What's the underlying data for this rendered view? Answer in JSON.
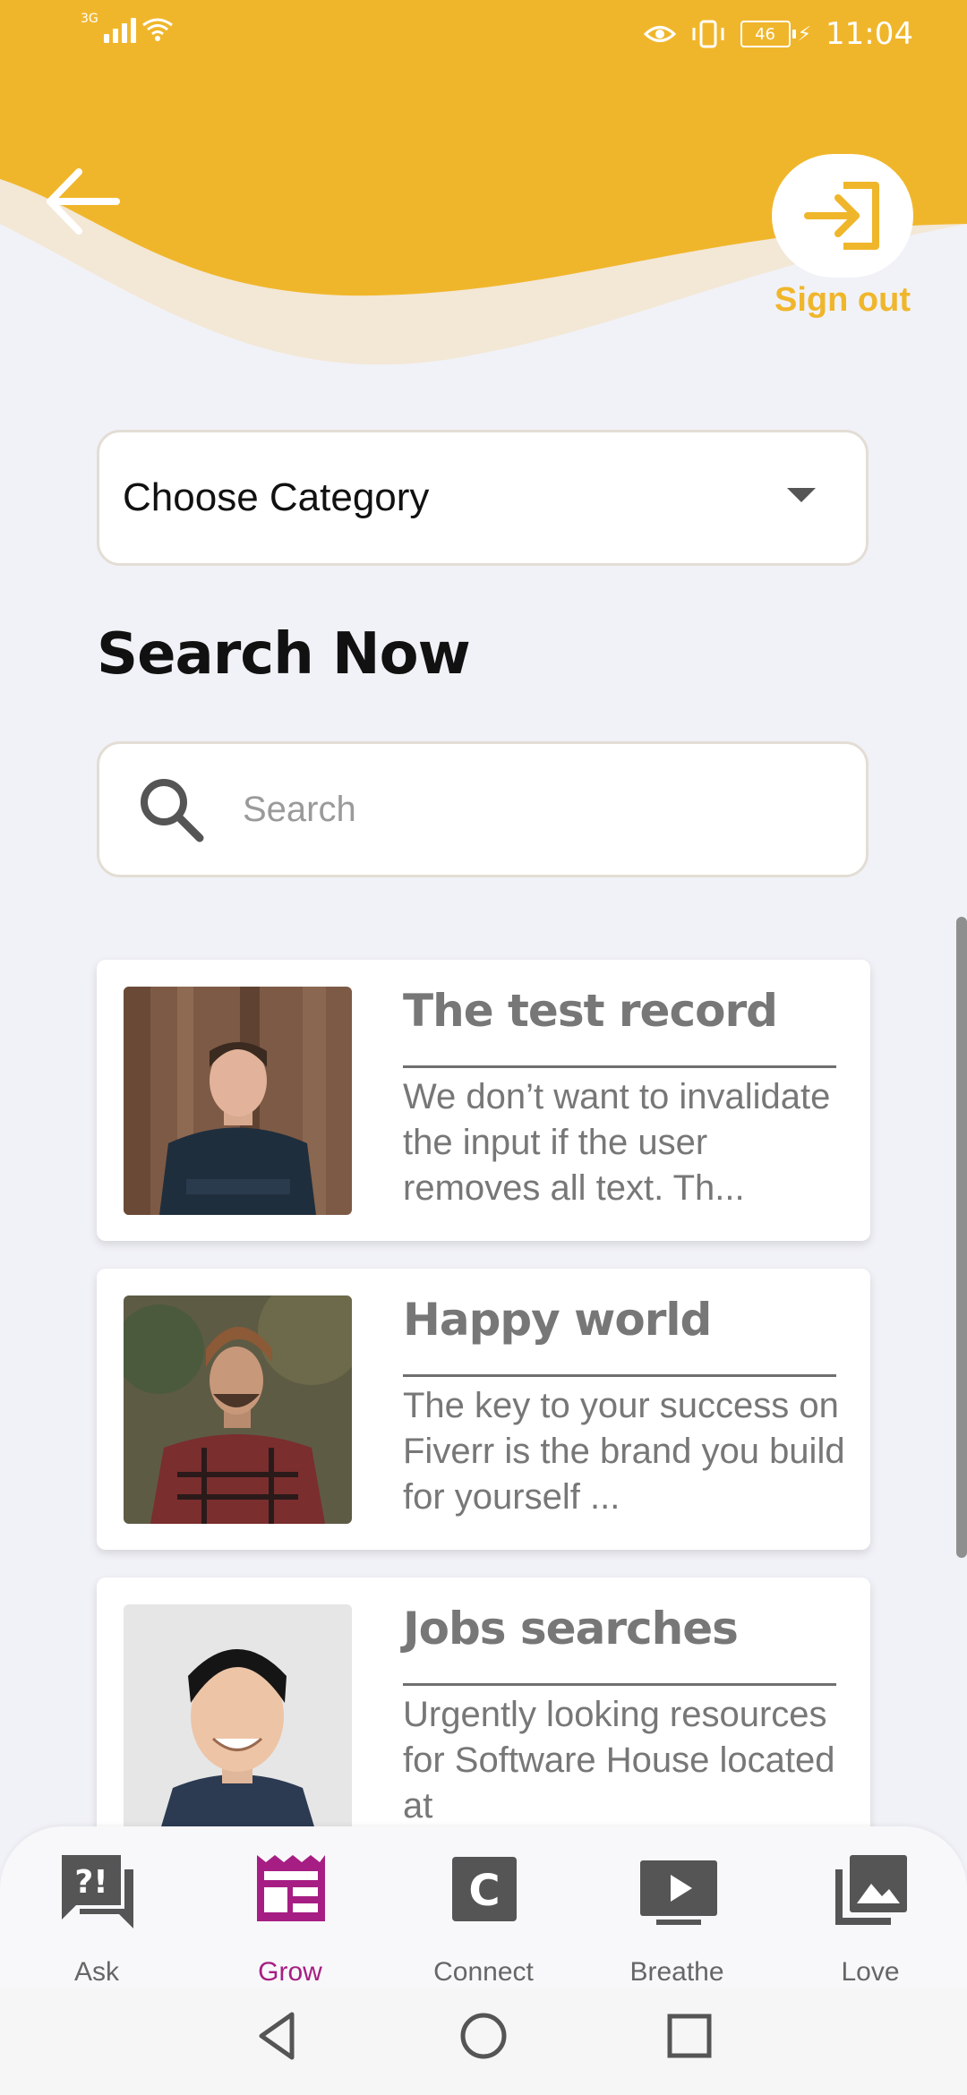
{
  "status_bar": {
    "network": "3G",
    "battery_level": "46",
    "time": "11:04"
  },
  "header": {
    "signout_label": "Sign out"
  },
  "filters": {
    "category_placeholder": "Choose Category",
    "search_title": "Search Now",
    "search_placeholder": "Search"
  },
  "cards": [
    {
      "title": "The test record",
      "description": "We don’t want to invalidate the input if the user removes all text. Th..."
    },
    {
      "title": "Happy world",
      "description": "The key to your success on Fiverr is the brand you build for yourself ..."
    },
    {
      "title": "Jobs searches",
      "description": "Urgently looking resources for Software House located at"
    }
  ],
  "bottom_nav": [
    {
      "label": "Ask",
      "icon": "question-chat-icon"
    },
    {
      "label": "Grow",
      "icon": "grow-layout-icon",
      "active": true
    },
    {
      "label": "Connect",
      "icon": "connect-c-icon"
    },
    {
      "label": "Breathe",
      "icon": "video-play-icon"
    },
    {
      "label": "Love",
      "icon": "photo-library-icon"
    }
  ],
  "colors": {
    "accent_yellow": "#F0B62B",
    "active_purple": "#A61E83",
    "background": "#F1F2F7"
  }
}
